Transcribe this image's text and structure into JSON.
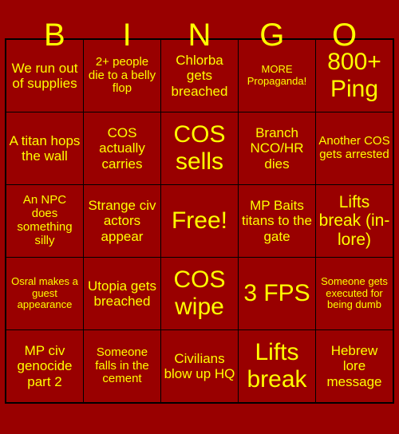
{
  "card": {
    "title": "BINGO",
    "background_color": "#990000",
    "text_color": "#FFFF00",
    "grid_line_color": "#000000",
    "header_letters": [
      "B",
      "I",
      "N",
      "G",
      "O"
    ],
    "rows": [
      [
        {
          "text": "We run out of supplies",
          "size": "md"
        },
        {
          "text": "2+ people die to a belly flop",
          "size": "sm"
        },
        {
          "text": "Chlorba gets breached",
          "size": "md"
        },
        {
          "text": "MORE Propaganda!",
          "size": "xs"
        },
        {
          "text": "800+ Ping",
          "size": "xl"
        }
      ],
      [
        {
          "text": "A titan hops the wall",
          "size": "md"
        },
        {
          "text": "COS actually carries",
          "size": "md"
        },
        {
          "text": "COS sells",
          "size": "xl"
        },
        {
          "text": "Branch NCO/HR dies",
          "size": "md"
        },
        {
          "text": "Another COS gets arrested",
          "size": "sm"
        }
      ],
      [
        {
          "text": "An NPC does something silly",
          "size": "sm"
        },
        {
          "text": "Strange civ actors appear",
          "size": "md"
        },
        {
          "text": "Free!",
          "size": "xl"
        },
        {
          "text": "MP Baits titans to the gate",
          "size": "md"
        },
        {
          "text": "Lifts break (in-lore)",
          "size": "lg"
        }
      ],
      [
        {
          "text": "Osral makes a guest appearance",
          "size": "xs"
        },
        {
          "text": "Utopia gets breached",
          "size": "md"
        },
        {
          "text": "COS wipe",
          "size": "xl"
        },
        {
          "text": "3 FPS",
          "size": "xl"
        },
        {
          "text": "Someone gets executed for being dumb",
          "size": "xs"
        }
      ],
      [
        {
          "text": "MP civ genocide part 2",
          "size": "md"
        },
        {
          "text": "Someone falls in the cement",
          "size": "sm"
        },
        {
          "text": "Civilians blow up HQ",
          "size": "md"
        },
        {
          "text": "Lifts break",
          "size": "xl"
        },
        {
          "text": "Hebrew lore message",
          "size": "md"
        }
      ]
    ]
  }
}
